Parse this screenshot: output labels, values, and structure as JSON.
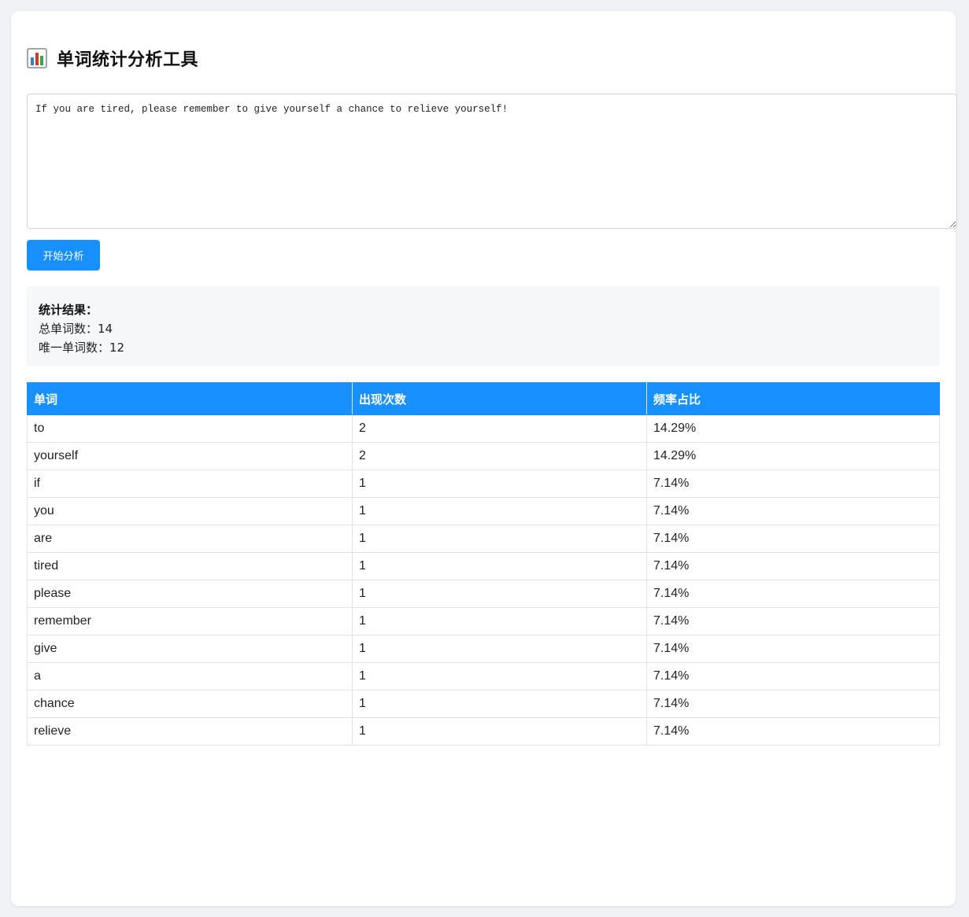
{
  "header": {
    "title": "单词统计分析工具",
    "icon": "bar-chart-icon"
  },
  "input": {
    "value": "If you are tired, please remember to give yourself a chance to relieve yourself!"
  },
  "actions": {
    "analyze_label": "开始分析"
  },
  "stats": {
    "heading": "统计结果：",
    "total_words": "总单词数：14",
    "unique_words": "唯一单词数：12"
  },
  "table": {
    "headers": [
      "单词",
      "出现次数",
      "频率占比"
    ],
    "rows": [
      [
        "to",
        "2",
        "14.29%"
      ],
      [
        "yourself",
        "2",
        "14.29%"
      ],
      [
        "if",
        "1",
        "7.14%"
      ],
      [
        "you",
        "1",
        "7.14%"
      ],
      [
        "are",
        "1",
        "7.14%"
      ],
      [
        "tired",
        "1",
        "7.14%"
      ],
      [
        "please",
        "1",
        "7.14%"
      ],
      [
        "remember",
        "1",
        "7.14%"
      ],
      [
        "give",
        "1",
        "7.14%"
      ],
      [
        "a",
        "1",
        "7.14%"
      ],
      [
        "chance",
        "1",
        "7.14%"
      ],
      [
        "relieve",
        "1",
        "7.14%"
      ]
    ]
  },
  "colors": {
    "accent": "#1890ff",
    "page_bg": "#f0f2f5",
    "stats_bg": "#f6f7f9"
  }
}
